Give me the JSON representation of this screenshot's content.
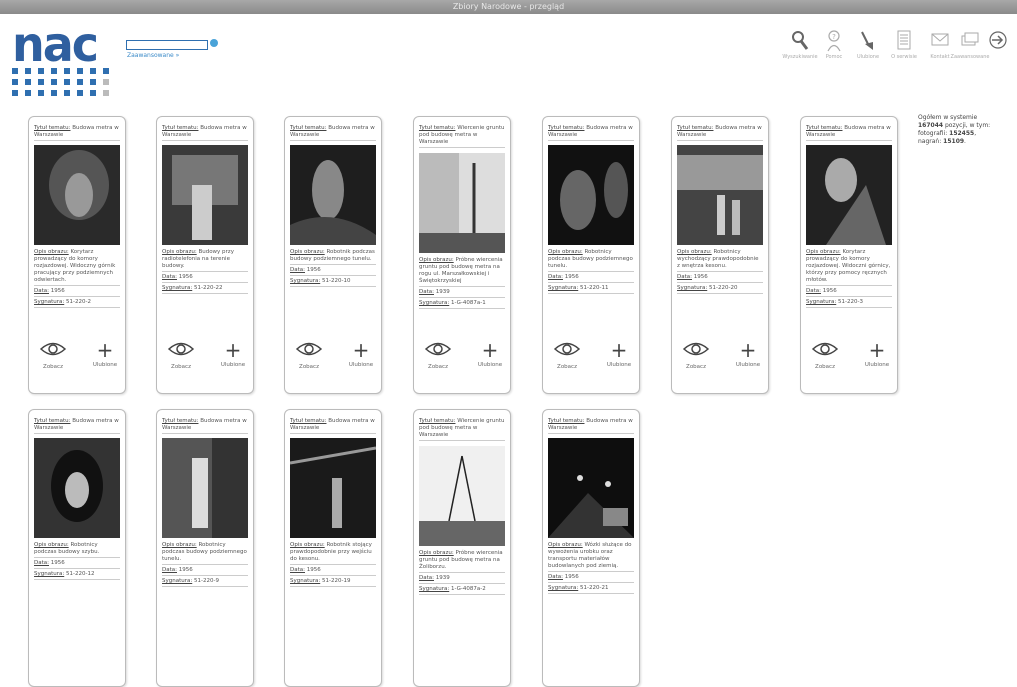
{
  "window": {
    "title": "Zbiory Narodowe - przegląd"
  },
  "header": {
    "logo": "nac",
    "advanced_search": "Zaawansowane »",
    "toolbar": [
      {
        "label": "Wyszukiwanie",
        "icon": "search-icon"
      },
      {
        "label": "Pomoc",
        "icon": "help-icon"
      },
      {
        "label": "Ulubione",
        "icon": "pin-icon"
      },
      {
        "label": "O serwisie",
        "icon": "document-icon"
      },
      {
        "label": "Kontakt",
        "icon": "mail-icon"
      },
      {
        "label": "Zaawansowane",
        "icon": "cards-icon"
      },
      {
        "label": "",
        "icon": "login-icon"
      }
    ]
  },
  "stats": {
    "line1": "Ogółem w systemie",
    "line2_pre": "",
    "total": "167044",
    "line2_post": " pozycji, w tym:",
    "line3_pre": "fotografii: ",
    "photos": "152455",
    "line3_post": ",",
    "line4_pre": "nagrań: ",
    "recordings": "15109",
    "line4_post": "."
  },
  "labels": {
    "title": "Tytuł tematu:",
    "desc": "Opis obrazu:",
    "date": "Data:",
    "sig": "Sygnatura:",
    "see": "Zobacz",
    "fav": "Ulubione"
  },
  "cards": [
    {
      "title": "Budowa metra w Warszawie",
      "desc": "Korytarz prowadzący do komory rozjazdowej. Widoczny górnik pracujący przy podziemnych odwiertach.",
      "date": "1956",
      "sig": "51-220-2"
    },
    {
      "title": "Budowa metra w Warszawie",
      "desc": "Budowy przy radiotelefonia na terenie budowy.",
      "date": "1956",
      "sig": "51-220-22"
    },
    {
      "title": "Budowa metra w Warszawie",
      "desc": "Robotnik podczas budowy podziemnego tunelu.",
      "date": "1956",
      "sig": "51-220-10"
    },
    {
      "title": "Wiercenie gruntu pod budowę metra w Warszawie",
      "desc": "Próbne wiercenia gruntu pod budowę metra na rogu ul. Marszałkowskiej i Świętokrzyskiej",
      "date": "1939",
      "sig": "1-G-4087a-1"
    },
    {
      "title": "Budowa metra w Warszawie",
      "desc": "Robotnicy podczas budowy podziemnego tunelu.",
      "date": "1956",
      "sig": "51-220-11"
    },
    {
      "title": "Budowa metra w Warszawie",
      "desc": "Robotnicy wychodzący prawdopodobnie z wnętrza kesonu.",
      "date": "1956",
      "sig": "51-220-20"
    },
    {
      "title": "Budowa metra w Warszawie",
      "desc": "Korytarz prowadzący do komory rozjazdowej. Widoczni górnicy, którzy przy pomocy ręcznych młotów.",
      "date": "1956",
      "sig": "51-220-3"
    },
    {
      "title": "Budowa metra w Warszawie",
      "desc": "Robotnicy podczas budowy szybu.",
      "date": "1956",
      "sig": "51-220-12"
    },
    {
      "title": "Budowa metra w Warszawie",
      "desc": "Robotnicy podczas budowy podziemnego tunelu.",
      "date": "1956",
      "sig": "51-220-9"
    },
    {
      "title": "Budowa metra w Warszawie",
      "desc": "Robotnik stojący prawdopodobnie przy wejściu do kesonu.",
      "date": "1956",
      "sig": "51-220-19"
    },
    {
      "title": "Wiercenie gruntu pod budowę metra w Warszawie",
      "desc": "Próbne wiercenia gruntu pod budowę metra na Żoliborzu.",
      "date": "1939",
      "sig": "1-G-4087a-2"
    },
    {
      "title": "Budowa metra w Warszawie",
      "desc": "Wózki służące do wywożenia urobku oraz transportu materiałów budowlanych pod ziemią.",
      "date": "1956",
      "sig": "51-220-21"
    }
  ]
}
